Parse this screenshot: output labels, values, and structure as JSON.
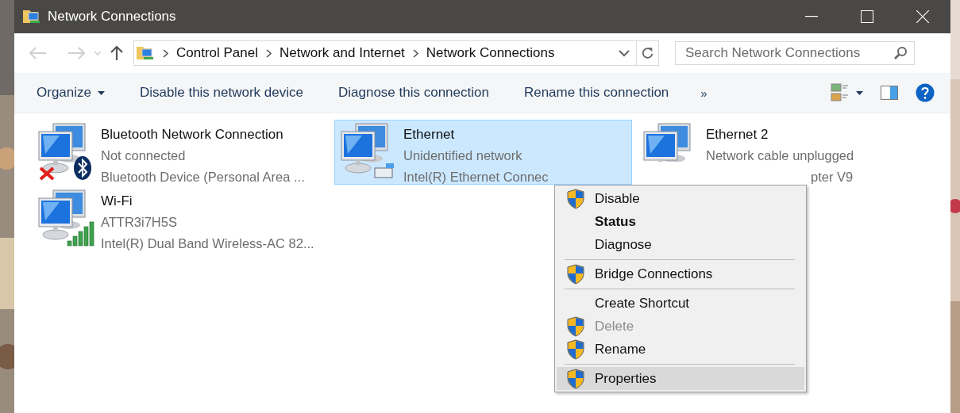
{
  "window": {
    "title": "Network Connections"
  },
  "address_bar": {
    "crumbs": [
      "Control Panel",
      "Network and Internet",
      "Network Connections"
    ]
  },
  "search": {
    "placeholder": "Search Network Connections"
  },
  "toolbar": {
    "organize": "Organize",
    "commands": [
      "Disable this network device",
      "Diagnose this connection",
      "Rename this connection"
    ],
    "more": "»"
  },
  "connections": [
    {
      "name": "Bluetooth Network Connection",
      "status": "Not connected",
      "device": "Bluetooth Device (Personal Area ...",
      "kind": "bluetooth",
      "disconnected": true,
      "selected": false
    },
    {
      "name": "Ethernet",
      "status": "Unidentified network",
      "device": "Intel(R) Ethernet Connec",
      "kind": "ethernet",
      "disconnected": false,
      "selected": true
    },
    {
      "name": "Ethernet 2",
      "status": "Network cable unplugged",
      "device": "pter V9",
      "selected": false
    },
    {
      "name": "Wi-Fi",
      "status": "ATTR3i7H5S",
      "device": "Intel(R) Dual Band Wireless-AC 82...",
      "kind": "wifi",
      "disconnected": false,
      "selected": false
    }
  ],
  "context_menu": [
    {
      "kind": "item",
      "label": "Disable",
      "shield": true,
      "bold": false,
      "disabled": false,
      "selected": false
    },
    {
      "kind": "item",
      "label": "Status",
      "shield": false,
      "bold": true,
      "disabled": false,
      "selected": false
    },
    {
      "kind": "item",
      "label": "Diagnose",
      "shield": false,
      "bold": false,
      "disabled": false,
      "selected": false
    },
    {
      "kind": "separator"
    },
    {
      "kind": "item",
      "label": "Bridge Connections",
      "shield": true,
      "bold": false,
      "disabled": false,
      "selected": false
    },
    {
      "kind": "separator"
    },
    {
      "kind": "item",
      "label": "Create Shortcut",
      "shield": false,
      "bold": false,
      "disabled": false,
      "selected": false
    },
    {
      "kind": "item",
      "label": "Delete",
      "shield": true,
      "bold": false,
      "disabled": true,
      "selected": false
    },
    {
      "kind": "item",
      "label": "Rename",
      "shield": true,
      "bold": false,
      "disabled": false,
      "selected": false
    },
    {
      "kind": "separator"
    },
    {
      "kind": "item",
      "label": "Properties",
      "shield": true,
      "bold": false,
      "disabled": false,
      "selected": true
    }
  ]
}
